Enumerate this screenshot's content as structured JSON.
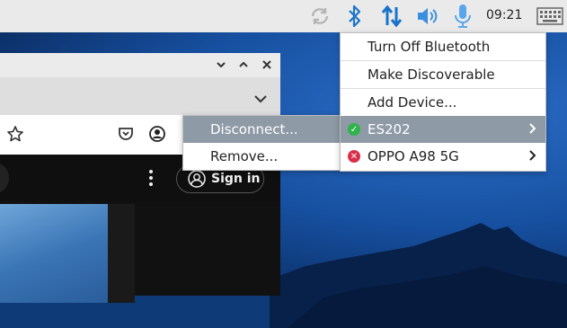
{
  "taskbar": {
    "icons": [
      "sync-icon",
      "bluetooth-icon",
      "network-icon",
      "volume-icon",
      "microphone-icon",
      "keyboard-icon"
    ],
    "clock": "09:21"
  },
  "bluetooth_menu": {
    "items": [
      {
        "label": "Turn Off Bluetooth"
      },
      {
        "label": "Make Discoverable"
      },
      {
        "label": "Add Device..."
      },
      {
        "label": "ES202",
        "status": "connected",
        "highlighted": true
      },
      {
        "label": "OPPO A98 5G",
        "status": "disconnected"
      }
    ]
  },
  "device_submenu": {
    "items": [
      {
        "label": "Disconnect...",
        "highlighted": true
      },
      {
        "label": "Remove..."
      }
    ]
  },
  "browser": {
    "sign_in": "Sign in"
  },
  "colors": {
    "taskbar_bg": "#eaeaea",
    "menu_highlight": "#8e9aa6",
    "bluetooth_blue": "#1a73c8",
    "connected_green": "#2fb34a",
    "disconnected_red": "#d9304a"
  }
}
